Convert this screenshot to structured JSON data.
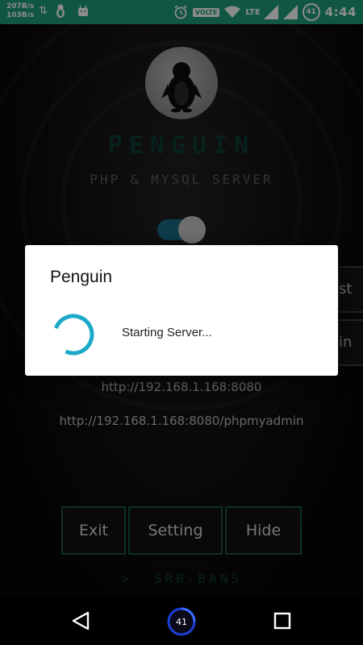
{
  "status_bar": {
    "net_up": "207B/s",
    "net_down": "103B/s",
    "volte": "VOLTE",
    "lte": "LTE",
    "badge": "41",
    "time": "4:44",
    "icons": [
      "arrows-icon",
      "penguin-icon",
      "android-icon",
      "alarm-icon",
      "wifi-icon",
      "signal-icon",
      "signal-icon-2"
    ]
  },
  "app": {
    "name": "PENGUIN",
    "subtitle": "PHP & MYSQL SERVER",
    "toggle_on": true,
    "side_buttons": [
      "st",
      "in"
    ],
    "urls": [
      "http://192.168.1.168:8080",
      "http://192.168.1.168:8080/phpmyadmin"
    ],
    "buttons": {
      "exit": "Exit",
      "setting": "Setting",
      "hide": "Hide"
    },
    "footer": ">_ SRB-BANS"
  },
  "dialog": {
    "title": "Penguin",
    "message": "Starting Server..."
  },
  "nav": {
    "home_badge": "41"
  },
  "colors": {
    "status_bar": "#1f9d7a",
    "accent": "#1fa9c9",
    "toggle_track": "#1a6b85",
    "button_border": "#17564c"
  }
}
